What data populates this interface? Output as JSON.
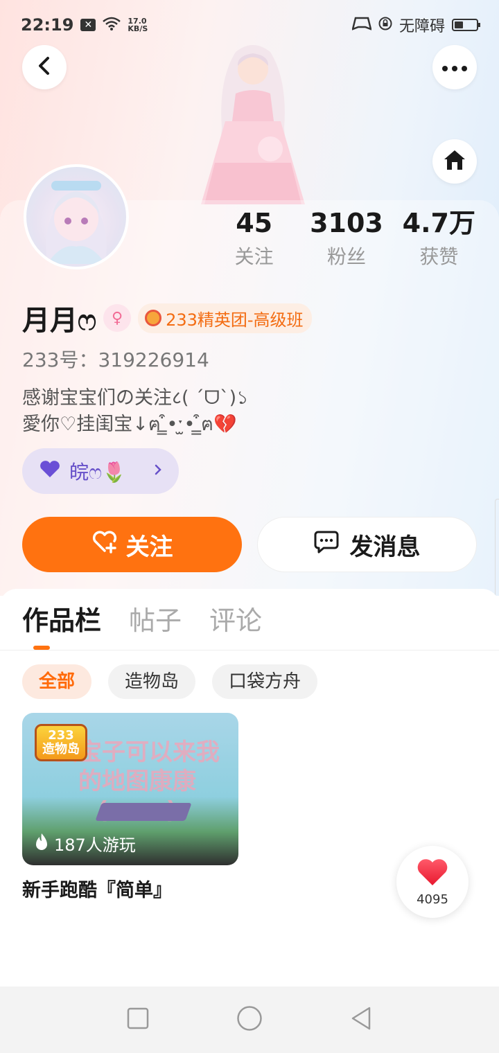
{
  "status_bar": {
    "time": "22:19",
    "speed_value": "17.0",
    "speed_unit": "KB/S",
    "accessibility": "无障碍"
  },
  "profile": {
    "stats": [
      {
        "value": "45",
        "label": "关注"
      },
      {
        "value": "3103",
        "label": "粉丝"
      },
      {
        "value": "4.7万",
        "label": "获赞"
      }
    ],
    "username": "月月ෆ",
    "gender_symbol": "♀",
    "group_badge": "233精英团-高级班",
    "uid": "233号：319226914",
    "bio_line1": "感谢宝宝们の关注८( ´ᗜ`)১",
    "bio_line2": "愛你♡挂闺宝↓ฅ ̳͒•ˑ̫• ̳͒ฅ💔",
    "friend_chip_label": "皖ෆ🌷"
  },
  "actions": {
    "follow_label": "关注",
    "message_label": "发消息"
  },
  "tabs": [
    "作品栏",
    "帖子",
    "评论"
  ],
  "filters": [
    "全部",
    "造物岛",
    "口袋方舟"
  ],
  "works": [
    {
      "logo_line1": "233",
      "logo_line2": "造物岛",
      "cover_text": "蟹宝子可以来我的地图康康(≧▽≦)",
      "play_count": "187人游玩",
      "title": "新手跑酷『简单』"
    }
  ],
  "like_fab": {
    "count": "4095"
  },
  "colors": {
    "accent": "#ff7210",
    "chip_purple": "#6650c9",
    "badge_orange": "#f36c12"
  }
}
